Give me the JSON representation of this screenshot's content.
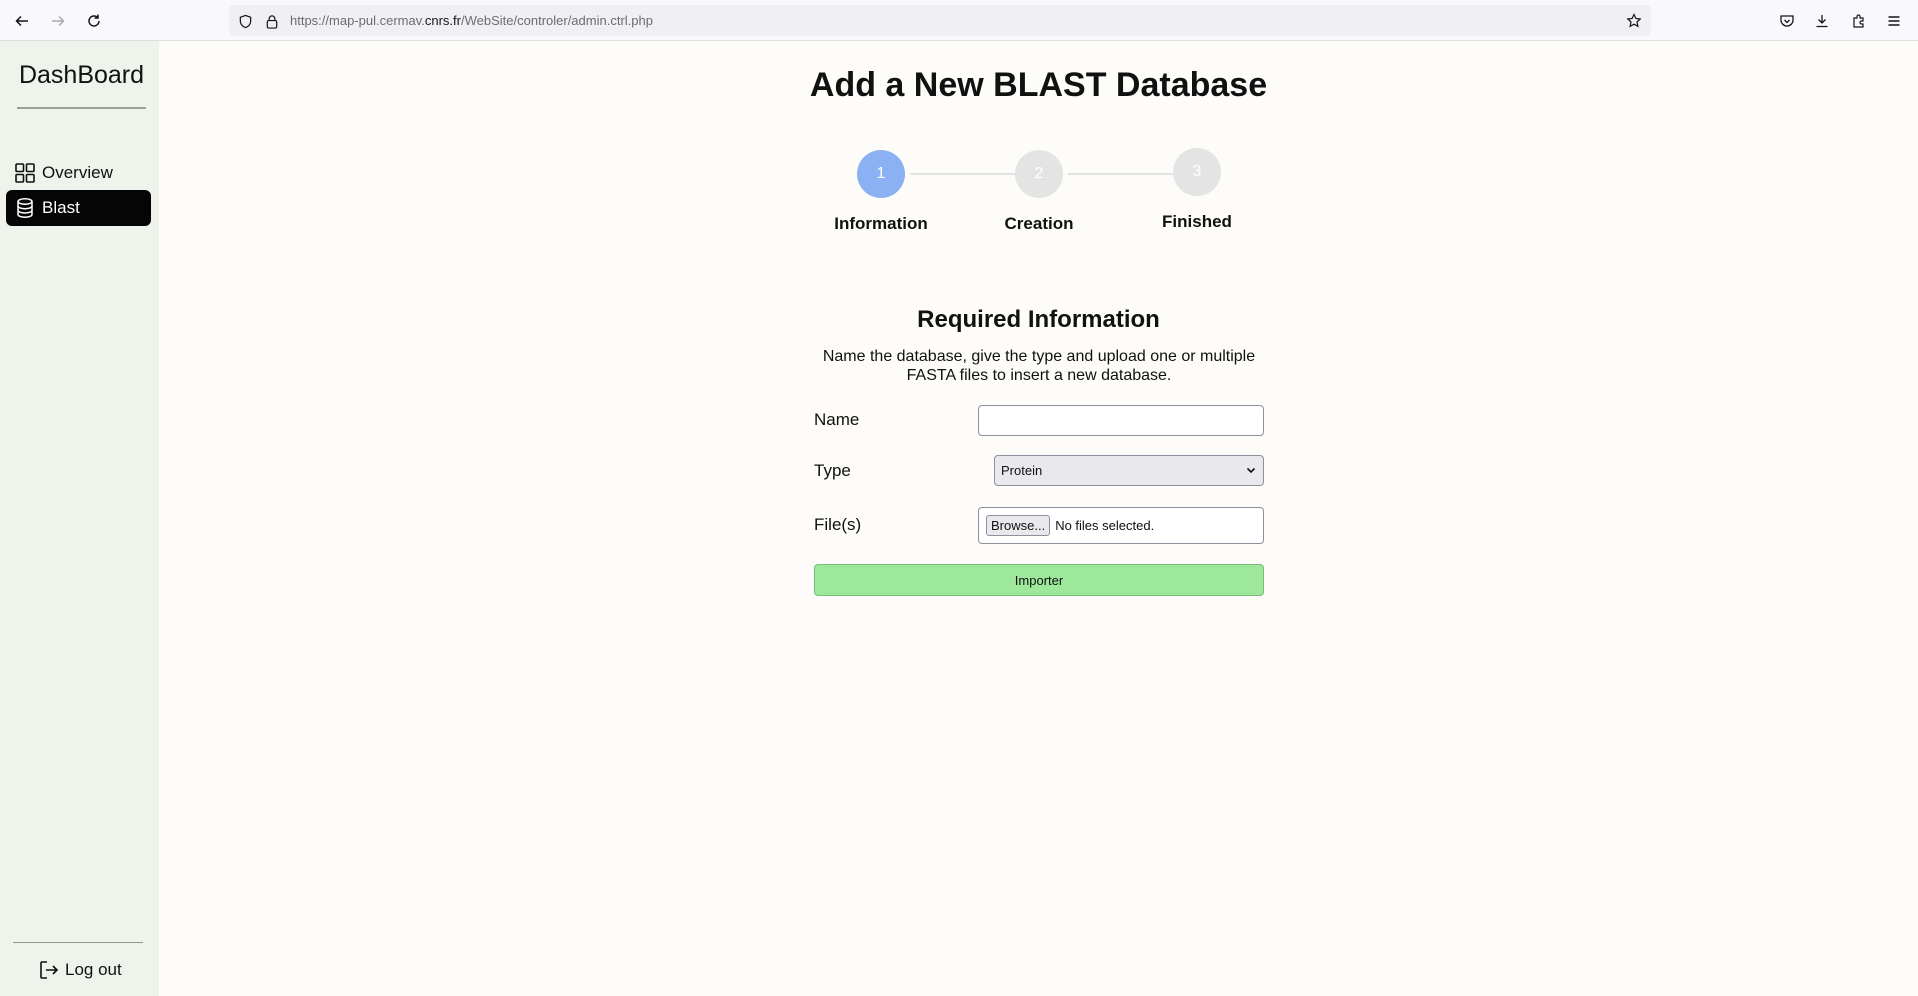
{
  "browser": {
    "url_prefix": "https://map-pul.cermav.",
    "url_domain": "cnrs.fr",
    "url_path": "/WebSite/controler/admin.ctrl.php"
  },
  "sidebar": {
    "brand": "DashBoard",
    "items": [
      {
        "label": "Overview",
        "icon": "grid-icon",
        "active": false
      },
      {
        "label": "Blast",
        "icon": "database-icon",
        "active": true
      }
    ],
    "logout_label": "Log out"
  },
  "main": {
    "title": "Add a New BLAST Database",
    "steps": [
      {
        "number": "1",
        "label": "Information",
        "state": "active",
        "color": "#8bb0f4"
      },
      {
        "number": "2",
        "label": "Creation",
        "state": "pending",
        "color": "#e4e4e4"
      },
      {
        "number": "3",
        "label": "Finished",
        "state": "pending",
        "color": "#e4e4e4"
      }
    ],
    "section_title": "Required Information",
    "section_desc": "Name the database, give the type and upload one or multiple FASTA files to insert a new database.",
    "form": {
      "name_label": "Name",
      "name_value": "",
      "type_label": "Type",
      "type_selected": "Protein",
      "files_label": "File(s)",
      "browse_label": "Browse...",
      "no_files_text": "No files selected.",
      "submit_label": "Importer"
    }
  },
  "colors": {
    "sidebar_bg": "#eef3ec",
    "active_item_bg": "#050505",
    "step_active": "#8bb0f4",
    "step_pending": "#e4e4e4",
    "submit_bg": "#9de89b"
  }
}
